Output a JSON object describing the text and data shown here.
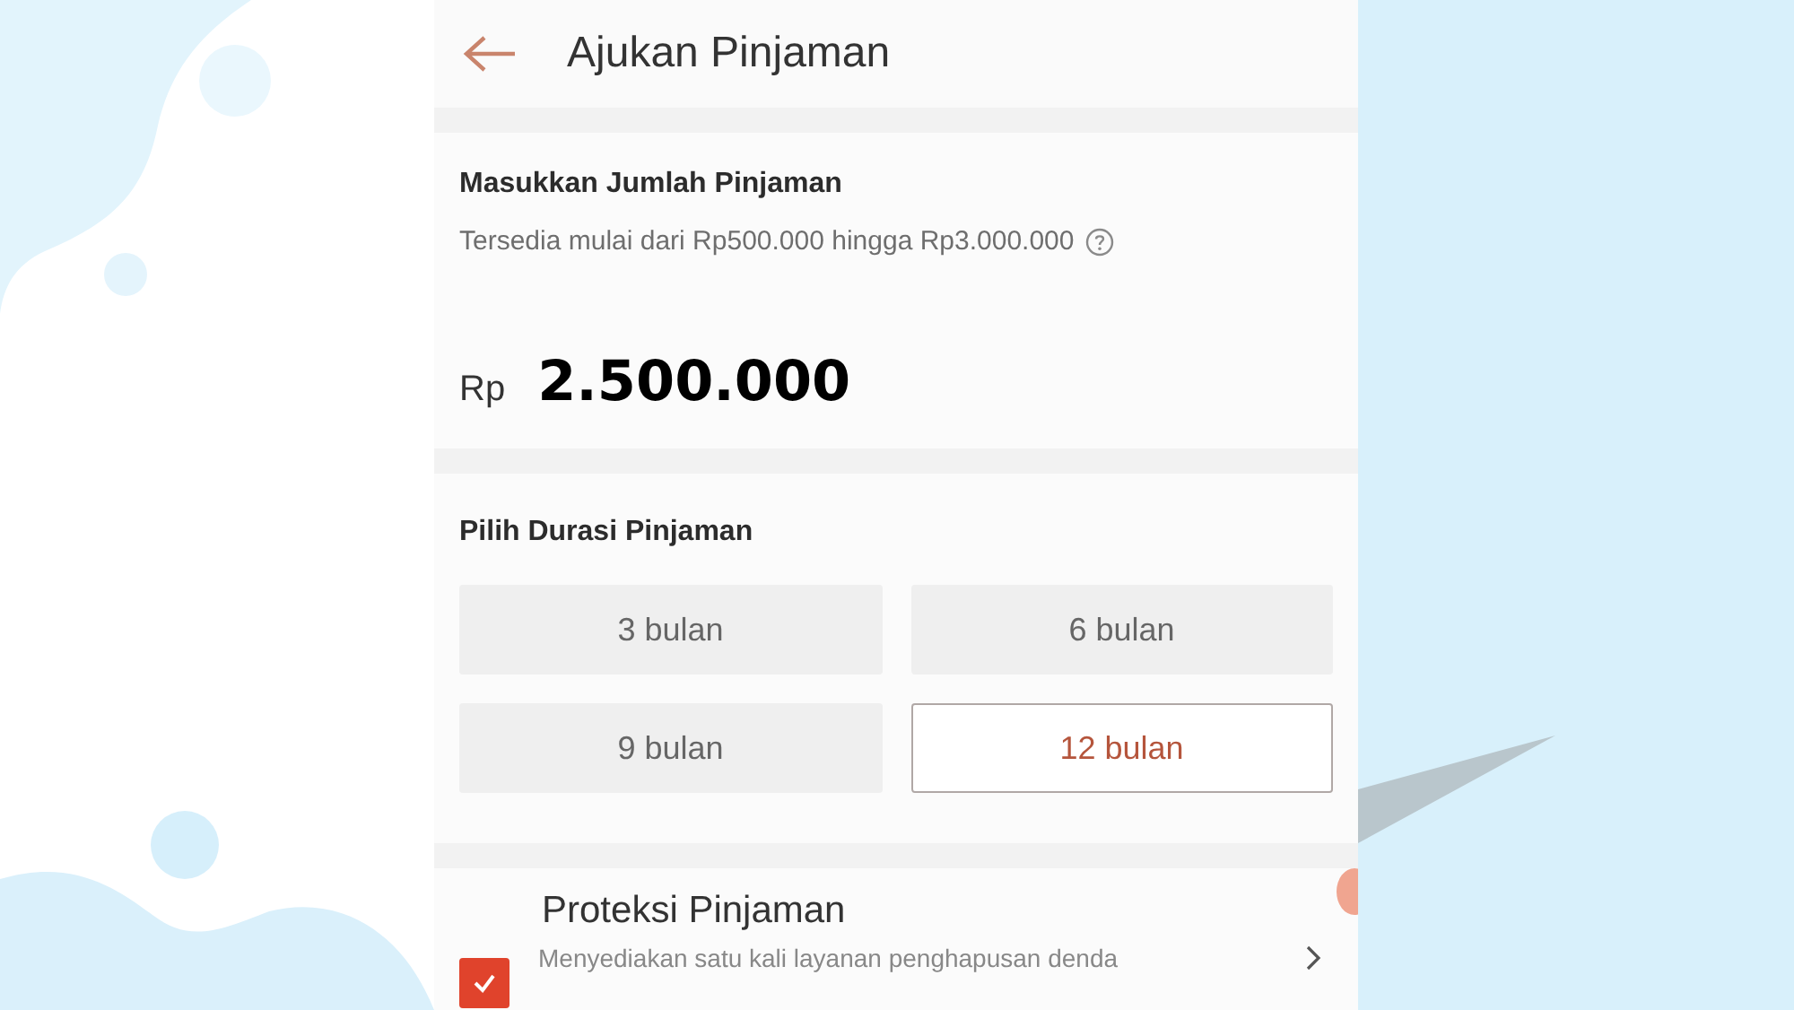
{
  "header": {
    "title": "Ajukan Pinjaman"
  },
  "amount_section": {
    "title": "Masukkan Jumlah Pinjaman",
    "hint": "Tersedia mulai dari Rp500.000 hingga Rp3.000.000",
    "currency": "Rp",
    "value": "2.500.000"
  },
  "duration_section": {
    "title": "Pilih Durasi Pinjaman",
    "options": [
      {
        "label": "3 bulan",
        "selected": false
      },
      {
        "label": "6 bulan",
        "selected": false
      },
      {
        "label": "9 bulan",
        "selected": false
      },
      {
        "label": "12 bulan",
        "selected": true
      }
    ]
  },
  "protection": {
    "title": "Proteksi Pinjaman",
    "description": "Menyediakan satu kali layanan penghapusan denda",
    "checked": true
  }
}
